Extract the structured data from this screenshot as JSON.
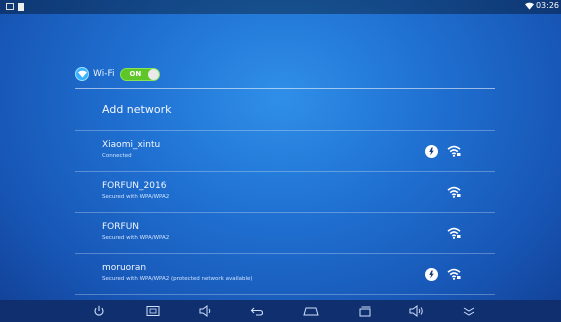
{
  "status_bar": {
    "time": "03:26"
  },
  "wifi": {
    "title": "Wi-Fi",
    "toggle": "ON"
  },
  "add_network": "Add network",
  "networks": [
    {
      "name": "Xiaomi_xintu",
      "status": "Connected",
      "wps": true
    },
    {
      "name": "FORFUN_2016",
      "status": "Secured with WPA/WPA2",
      "wps": false
    },
    {
      "name": "FORFUN",
      "status": "Secured with WPA/WPA2",
      "wps": false
    },
    {
      "name": "moruoran",
      "status": "Secured with WPA/WPA2 (protected network available)",
      "wps": true
    }
  ],
  "nav_bar": [
    "power-icon",
    "screenshot-icon",
    "volume-down-icon",
    "back-icon",
    "home-icon",
    "recents-icon",
    "volume-up-icon",
    "collapse-icon"
  ],
  "colors": {
    "toggle_on": "#5fc629",
    "background": "#1f6fd0",
    "nav_bar": "#0f2f6e"
  }
}
